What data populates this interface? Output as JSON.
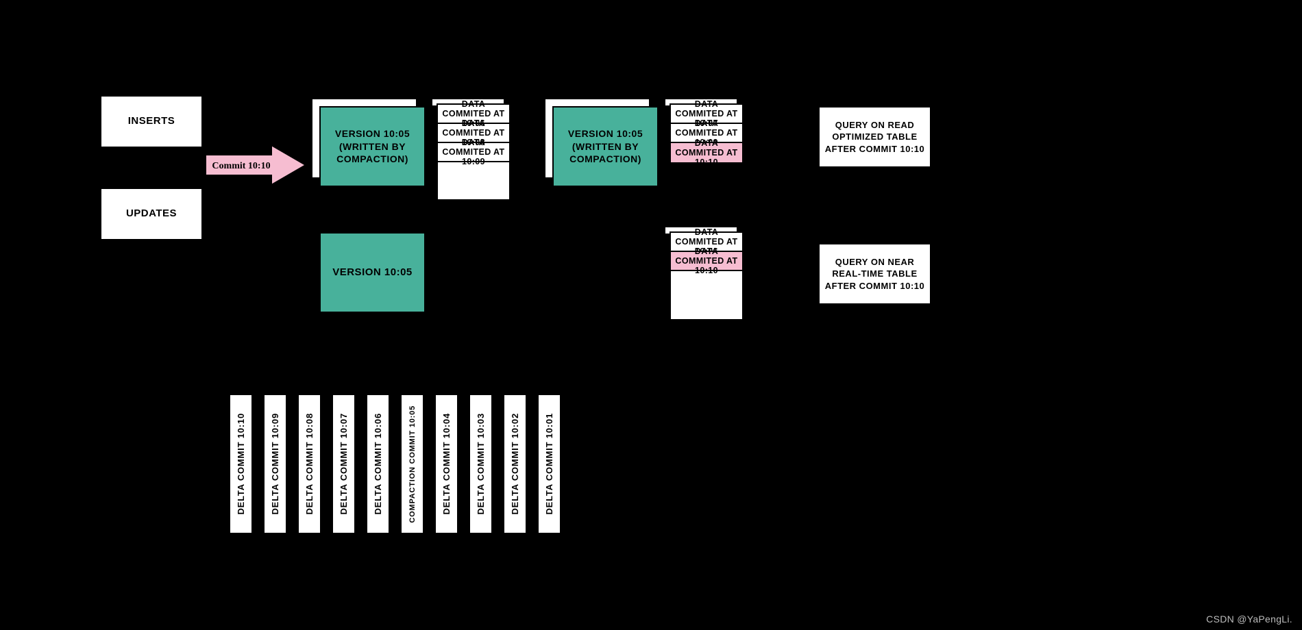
{
  "inputs": {
    "inserts": "INSERTS",
    "updates": "UPDATES"
  },
  "arrow": {
    "label": "Commit 10:10"
  },
  "before": {
    "version_top": "VERSION 10:05 (WRITTEN BY COMPACTION)",
    "version_bottom": "VERSION 10:05",
    "commits": [
      "DATA COMMITED AT 10:06",
      "DATA COMMITED AT 10:08",
      "DATA COMMITED AT 10:09"
    ]
  },
  "after": {
    "version_top": "VERSION 10:05 (WRITTEN BY COMPACTION)",
    "commits_top": [
      "DATA COMMITED AT 10:07",
      "DATA COMMITED AT 10:09",
      "DATA COMMITED AT 10:10"
    ],
    "commits_bottom": [
      "DATA COMMITED AT 10:06",
      "DATA COMMITED AT 10:10"
    ],
    "highlight_top_index": 2,
    "highlight_bottom_index": 1
  },
  "queries": {
    "read_optimized": "QUERY ON READ OPTIMIZED TABLE AFTER COMMIT 10:10",
    "near_realtime": "QUERY ON NEAR REAL-TIME TABLE AFTER COMMIT 10:10"
  },
  "timeline": [
    {
      "label": "DELTA COMMIT 10:10"
    },
    {
      "label": "DELTA COMMIT 10:09"
    },
    {
      "label": "DELTA COMMIT 10:08"
    },
    {
      "label": "DELTA COMMIT 10:07"
    },
    {
      "label": "DELTA COMMIT 10:06"
    },
    {
      "label": "COMPACTION COMMIT 10:05",
      "teal": true
    },
    {
      "label": "DELTA COMMIT 10:04"
    },
    {
      "label": "DELTA COMMIT 10:03"
    },
    {
      "label": "DELTA COMMIT 10:02"
    },
    {
      "label": "DELTA COMMIT 10:01"
    }
  ],
  "watermark": "CSDN @YaPengLi."
}
